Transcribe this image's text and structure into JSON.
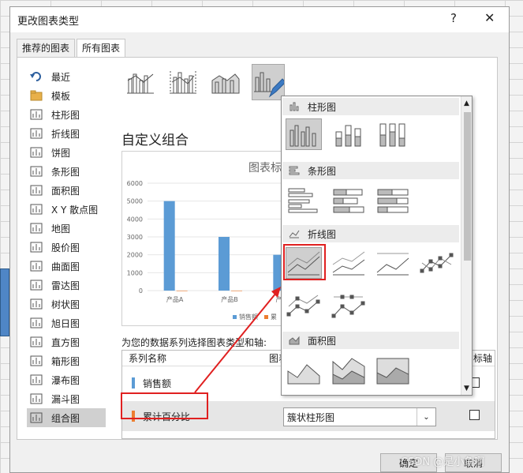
{
  "window": {
    "title": "更改图表类型",
    "help_label": "?",
    "close_label": "✕"
  },
  "tabs": [
    {
      "label": "推荐的图表"
    },
    {
      "label": "所有图表"
    }
  ],
  "sidebar": {
    "items": [
      {
        "label": "最近",
        "icon": "undo-icon"
      },
      {
        "label": "模板",
        "icon": "folder-icon"
      },
      {
        "label": "柱形图",
        "icon": "column-chart-icon"
      },
      {
        "label": "折线图",
        "icon": "line-chart-icon"
      },
      {
        "label": "饼图",
        "icon": "pie-chart-icon"
      },
      {
        "label": "条形图",
        "icon": "bar-chart-icon"
      },
      {
        "label": "面积图",
        "icon": "area-chart-icon"
      },
      {
        "label": "X Y 散点图",
        "icon": "scatter-chart-icon"
      },
      {
        "label": "地图",
        "icon": "map-chart-icon"
      },
      {
        "label": "股价图",
        "icon": "stock-chart-icon"
      },
      {
        "label": "曲面图",
        "icon": "surface-chart-icon"
      },
      {
        "label": "雷达图",
        "icon": "radar-chart-icon"
      },
      {
        "label": "树状图",
        "icon": "treemap-chart-icon"
      },
      {
        "label": "旭日图",
        "icon": "sunburst-chart-icon"
      },
      {
        "label": "直方图",
        "icon": "histogram-chart-icon"
      },
      {
        "label": "箱形图",
        "icon": "boxplot-chart-icon"
      },
      {
        "label": "瀑布图",
        "icon": "waterfall-chart-icon"
      },
      {
        "label": "漏斗图",
        "icon": "funnel-chart-icon"
      },
      {
        "label": "组合图",
        "icon": "combo-chart-icon"
      }
    ],
    "selected": "组合图"
  },
  "main": {
    "heading": "自定义组合",
    "series_prompt": "为您的数据系列选择图表类型和轴:",
    "grid_headers": {
      "series_name": "系列名称",
      "chart_type": "图表",
      "axis": "标轴"
    },
    "rows": [
      {
        "name": "销售额",
        "color": "#5b9bd5",
        "chart_type": ""
      },
      {
        "name": "累计百分比",
        "color": "#ed7d31",
        "chart_type": "簇状柱形图"
      }
    ]
  },
  "chart_data": {
    "type": "bar",
    "title": "图表标",
    "categories": [
      "产品A",
      "产品B",
      "产品C"
    ],
    "series": [
      {
        "name": "销售额",
        "values": [
          5000,
          3000,
          2000
        ]
      },
      {
        "name": "累",
        "values": [
          0.5,
          0.8,
          1.0
        ]
      }
    ],
    "yticks": [
      "6000",
      "5000",
      "4000",
      "3000",
      "2000",
      "1000",
      "0"
    ],
    "ylim": [
      0,
      6000
    ],
    "legend": "bottom"
  },
  "popup": {
    "sections": [
      {
        "label": "柱形图"
      },
      {
        "label": "条形图"
      },
      {
        "label": "折线图"
      },
      {
        "label": "面积图"
      }
    ]
  },
  "buttons": {
    "ok": "确定",
    "cancel": "取消"
  },
  "watermark": "CSDN @是小鱼啊",
  "colors": {
    "accent_red": "#e02020",
    "blue": "#5b9bd5",
    "orange": "#ed7d31"
  }
}
